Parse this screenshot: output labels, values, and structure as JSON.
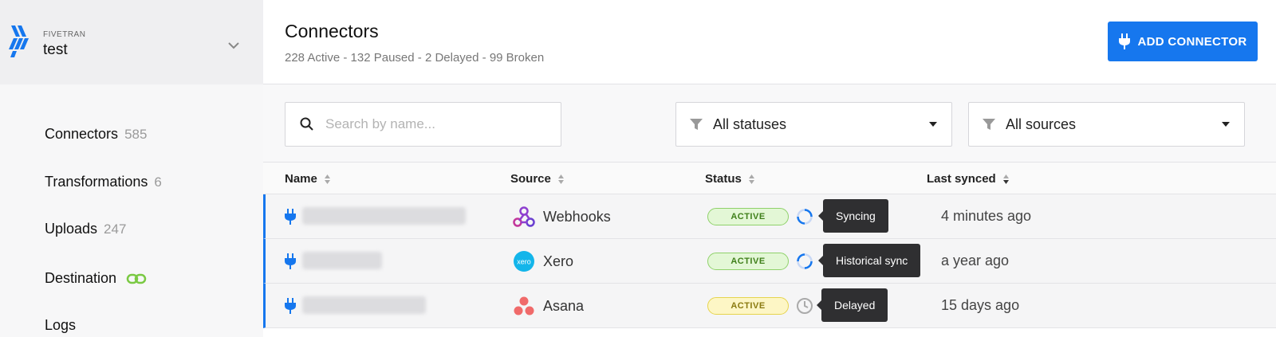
{
  "sidebar": {
    "org_label": "FIVETRAN",
    "org_name": "test",
    "items": [
      {
        "label": "Connectors",
        "count": "585"
      },
      {
        "label": "Transformations",
        "count": "6"
      },
      {
        "label": "Uploads",
        "count": "247"
      },
      {
        "label": "Destination",
        "count": ""
      },
      {
        "label": "Logs",
        "count": ""
      }
    ]
  },
  "header": {
    "title": "Connectors",
    "subtitle": "228 Active - 132 Paused - 2 Delayed - 99 Broken",
    "add_button": "ADD CONNECTOR"
  },
  "filters": {
    "search_placeholder": "Search by name...",
    "status_value": "All statuses",
    "source_value": "All sources"
  },
  "table": {
    "columns": [
      "Name",
      "Source",
      "Status",
      "Last synced"
    ],
    "rows": [
      {
        "source": "Webhooks",
        "status": "ACTIVE",
        "status_color": "green",
        "indicator": "spinner-icon",
        "tooltip": "Syncing",
        "last_synced": "4 minutes ago"
      },
      {
        "source": "Xero",
        "status": "ACTIVE",
        "status_color": "green",
        "indicator": "spinner-icon",
        "tooltip": "Historical sync",
        "last_synced": "a year ago"
      },
      {
        "source": "Asana",
        "status": "ACTIVE",
        "status_color": "yellow",
        "indicator": "clock-icon",
        "tooltip": "Delayed",
        "last_synced": "15 days ago"
      }
    ]
  },
  "colors": {
    "accent": "#1677ee",
    "link_green": "#7ac943"
  }
}
